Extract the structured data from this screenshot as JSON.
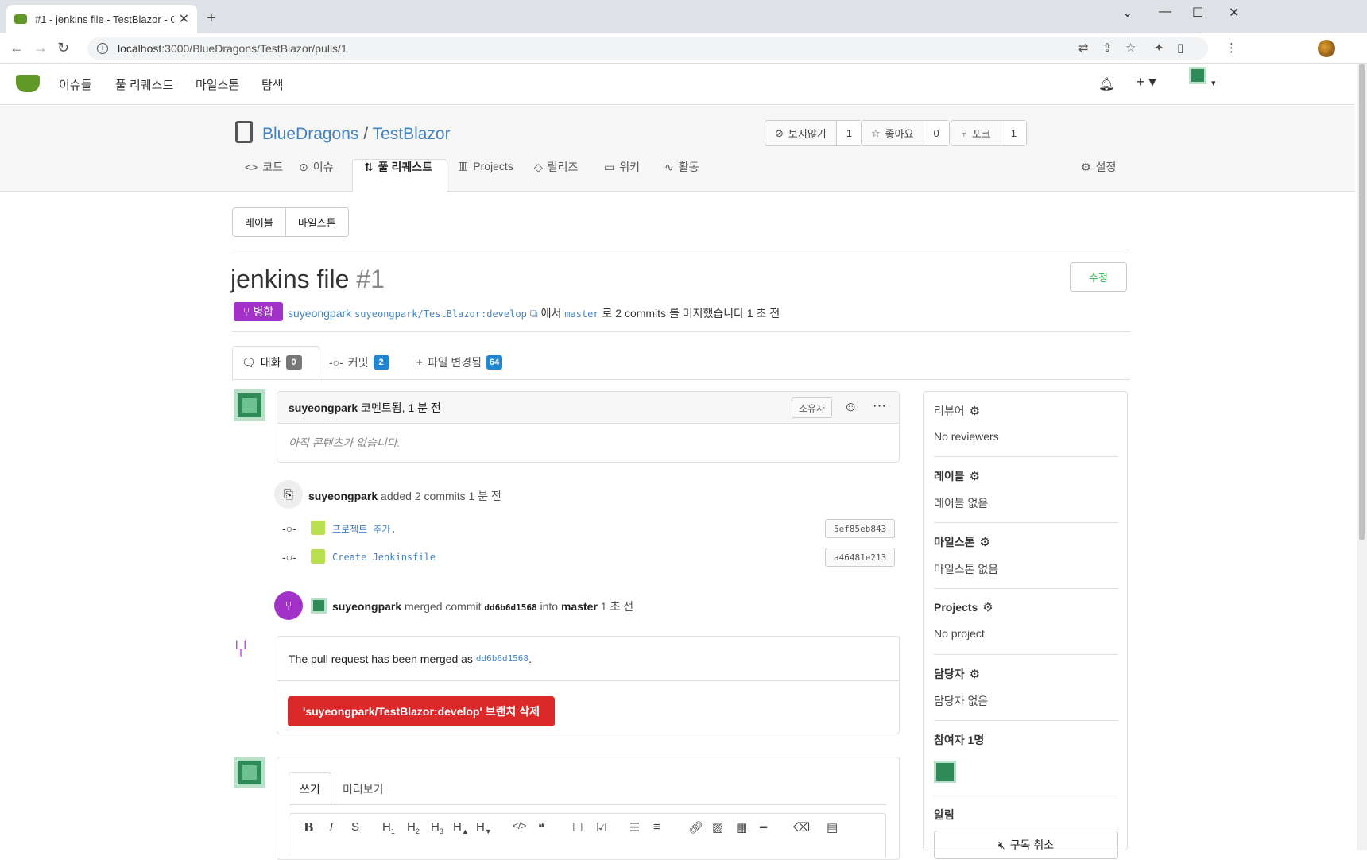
{
  "browser": {
    "tab_title": "#1 - jenkins file - TestBlazor - G",
    "url_host": "localhost",
    "url_rest": ":3000/BlueDragons/TestBlazor/pulls/1",
    "new_tab": "+",
    "close": "✕"
  },
  "topnav": {
    "issues": "이슈들",
    "pulls": "풀 리퀘스트",
    "milestones": "마일스톤",
    "explore": "탐색"
  },
  "repo": {
    "owner": "BlueDragons",
    "separator": "/",
    "name": "TestBlazor",
    "watch_label": "보지않기",
    "watch_count": "1",
    "star_label": "좋아요",
    "star_count": "0",
    "fork_label": "포크",
    "fork_count": "1",
    "tabs": {
      "code": "코드",
      "issues": "이슈",
      "pulls": "풀 리퀘스트",
      "projects": "Projects",
      "releases": "릴리즈",
      "wiki": "위키",
      "activity": "활동",
      "settings": "설정"
    }
  },
  "filters": {
    "labels": "레이블",
    "milestones": "마일스톤"
  },
  "pr": {
    "title": "jenkins file",
    "number": "#1",
    "edit": "수정",
    "merged_badge": "병합",
    "author": "suyeongpark",
    "head_branch": "suyeongpark/TestBlazor:develop",
    "from_word": "에서",
    "base_branch": "master",
    "to_text": "로 2 commits 를 머지했습니다 1 초 전",
    "tabs": {
      "conversation": "대화",
      "conversation_count": "0",
      "commits": "커밋",
      "commits_count": "2",
      "files": "파일 변경됨",
      "files_count": "64"
    }
  },
  "timeline": {
    "first_comment": {
      "author": "suyeongpark",
      "action": "코멘트됨, 1 분 전",
      "owner_badge": "소유자",
      "body": "아직 콘텐츠가 없습니다."
    },
    "commits_event": {
      "author": "suyeongpark",
      "text": "added 2 commits 1 분 전",
      "commits": [
        {
          "message": "프로젝트 추가.",
          "sha": "5ef85eb843"
        },
        {
          "message": "Create Jenkinsfile",
          "sha": "a46481e213"
        }
      ]
    },
    "merge_event": {
      "author": "suyeongpark",
      "text1": "merged commit",
      "sha": "dd6b6d1568",
      "text2": "into",
      "branch": "master",
      "time": "1 초 전"
    },
    "merged_box": {
      "text": "The pull request has been merged as",
      "sha": "dd6b6d1568",
      "period": ".",
      "delete_button": "'suyeongpark/TestBlazor:develop' 브랜치 삭제"
    }
  },
  "editor": {
    "write_tab": "쓰기",
    "preview_tab": "미리보기"
  },
  "sidebar": {
    "reviewers_label": "리뷰어",
    "reviewers_value": "No reviewers",
    "labels_label": "레이블",
    "labels_value": "레이블 없음",
    "milestone_label": "마일스톤",
    "milestone_value": "마일스톤 없음",
    "projects_label": "Projects",
    "projects_value": "No project",
    "assignees_label": "담당자",
    "assignees_value": "담당자 없음",
    "participants_label": "참여자 1명",
    "notifications_label": "알림",
    "unsubscribe": "구독 취소"
  },
  "colors": {
    "merged": "#a333c8",
    "danger": "#db2828",
    "link": "#4183c4",
    "accent": "#609926"
  }
}
